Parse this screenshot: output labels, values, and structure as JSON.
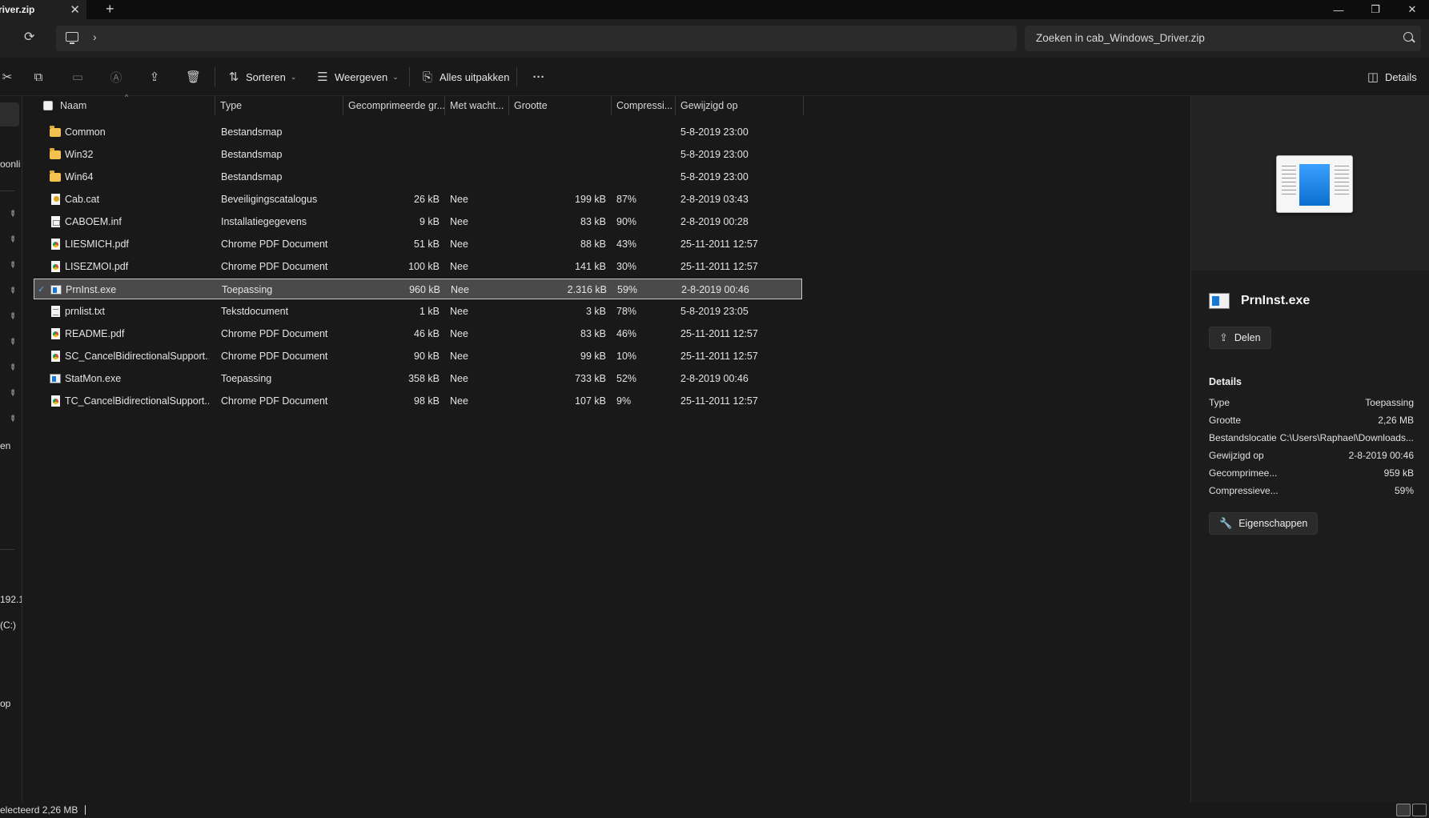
{
  "tab": {
    "title": "river.zip",
    "close": "✕",
    "new_tab": "+"
  },
  "window": {
    "minimize": "—",
    "restore": "❐",
    "close": "✕"
  },
  "address": {
    "chevron": "›",
    "search_placeholder": "Zoeken in cab_Windows_Driver.zip"
  },
  "toolbar": {
    "sort_label": "Sorteren",
    "view_label": "Weergeven",
    "extract_label": "Alles uitpakken",
    "more_label": "···",
    "details_label": "Details"
  },
  "leftnav": {
    "items": [
      "oonli",
      "en",
      "192.1",
      "(C:)",
      "op"
    ]
  },
  "columns": {
    "name": "Naam",
    "type": "Type",
    "compressed": "Gecomprimeerde gr...",
    "password": "Met wacht...",
    "size": "Grootte",
    "ratio": "Compressi...",
    "modified": "Gewijzigd op"
  },
  "files": [
    {
      "name": "Common",
      "type": "Bestandsmap",
      "compressed": "",
      "password": "",
      "size": "",
      "ratio": "",
      "modified": "5-8-2019 23:00",
      "icon": "folder-icon"
    },
    {
      "name": "Win32",
      "type": "Bestandsmap",
      "compressed": "",
      "password": "",
      "size": "",
      "ratio": "",
      "modified": "5-8-2019 23:00",
      "icon": "folder-icon"
    },
    {
      "name": "Win64",
      "type": "Bestandsmap",
      "compressed": "",
      "password": "",
      "size": "",
      "ratio": "",
      "modified": "5-8-2019 23:00",
      "icon": "folder-icon"
    },
    {
      "name": "Cab.cat",
      "type": "Beveiligingscatalogus",
      "compressed": "26 kB",
      "password": "Nee",
      "size": "199 kB",
      "ratio": "87%",
      "modified": "2-8-2019 03:43",
      "icon": "catalog-icon"
    },
    {
      "name": "CABOEM.inf",
      "type": "Installatiegegevens",
      "compressed": "9 kB",
      "password": "Nee",
      "size": "83 kB",
      "ratio": "90%",
      "modified": "2-8-2019 00:28",
      "icon": "inf-icon"
    },
    {
      "name": "LIESMICH.pdf",
      "type": "Chrome PDF Document",
      "compressed": "51 kB",
      "password": "Nee",
      "size": "88 kB",
      "ratio": "43%",
      "modified": "25-11-2011 12:57",
      "icon": "pdf-icon"
    },
    {
      "name": "LISEZMOI.pdf",
      "type": "Chrome PDF Document",
      "compressed": "100 kB",
      "password": "Nee",
      "size": "141 kB",
      "ratio": "30%",
      "modified": "25-11-2011 12:57",
      "icon": "pdf-icon"
    },
    {
      "name": "PrnInst.exe",
      "type": "Toepassing",
      "compressed": "960 kB",
      "password": "Nee",
      "size": "2.316 kB",
      "ratio": "59%",
      "modified": "2-8-2019 00:46",
      "icon": "exe-icon",
      "selected": true
    },
    {
      "name": "prnlist.txt",
      "type": "Tekstdocument",
      "compressed": "1 kB",
      "password": "Nee",
      "size": "3 kB",
      "ratio": "78%",
      "modified": "5-8-2019 23:05",
      "icon": "txt-icon"
    },
    {
      "name": "README.pdf",
      "type": "Chrome PDF Document",
      "compressed": "46 kB",
      "password": "Nee",
      "size": "83 kB",
      "ratio": "46%",
      "modified": "25-11-2011 12:57",
      "icon": "pdf-icon"
    },
    {
      "name": "SC_CancelBidirectionalSupport....",
      "type": "Chrome PDF Document",
      "compressed": "90 kB",
      "password": "Nee",
      "size": "99 kB",
      "ratio": "10%",
      "modified": "25-11-2011 12:57",
      "icon": "pdf-icon"
    },
    {
      "name": "StatMon.exe",
      "type": "Toepassing",
      "compressed": "358 kB",
      "password": "Nee",
      "size": "733 kB",
      "ratio": "52%",
      "modified": "2-8-2019 00:46",
      "icon": "exe-icon"
    },
    {
      "name": "TC_CancelBidirectionalSupport....",
      "type": "Chrome PDF Document",
      "compressed": "98 kB",
      "password": "Nee",
      "size": "107 kB",
      "ratio": "9%",
      "modified": "25-11-2011 12:57",
      "icon": "pdf-icon"
    }
  ],
  "details": {
    "title": "PrnInst.exe",
    "share_label": "Delen",
    "section": "Details",
    "props": [
      {
        "k": "Type",
        "v": "Toepassing"
      },
      {
        "k": "Grootte",
        "v": "2,26 MB"
      },
      {
        "k": "Bestandslocatie",
        "v": "C:\\Users\\Raphael\\Downloads..."
      },
      {
        "k": "Gewijzigd op",
        "v": "2-8-2019 00:46"
      },
      {
        "k": "Gecomprimee...",
        "v": "959 kB"
      },
      {
        "k": "Compressieve...",
        "v": "59%"
      }
    ],
    "properties_label": "Eigenschappen"
  },
  "status": {
    "text": "electeerd  2,26 MB"
  },
  "colors": {
    "background": "#191919",
    "selection": "#4a4a4a",
    "accent": "#1479d6"
  }
}
